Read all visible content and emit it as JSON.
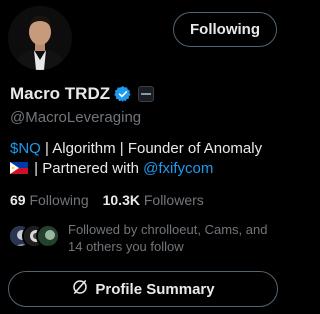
{
  "profile": {
    "name": "Macro TRDZ",
    "handle": "@MacroLeveraging",
    "follow_button_label": "Following",
    "bio": {
      "cashtag": "$NQ",
      "line1_rest": " | Algorithm | Founder of Anomaly",
      "line2_prefix": " | Partnered with ",
      "mention": "@fxifycom"
    },
    "stats": {
      "following_count": "69",
      "following_label": "Following",
      "followers_count": "10.3K",
      "followers_label": "Followers"
    },
    "followed_by": "Followed by chrolloeut, Cams, and 14 others you follow",
    "summary_button_label": "Profile Summary"
  },
  "colors": {
    "background": "#000000",
    "text": "#e7e9ea",
    "muted": "#71767b",
    "link": "#1d9bf0",
    "border": "#536471",
    "verified": "#1d9bf0"
  },
  "icons": {
    "verified": "verified-badge-icon",
    "affiliate": "affiliate-badge-icon",
    "flag": "philippines-flag-icon",
    "summary": "grok-icon"
  }
}
